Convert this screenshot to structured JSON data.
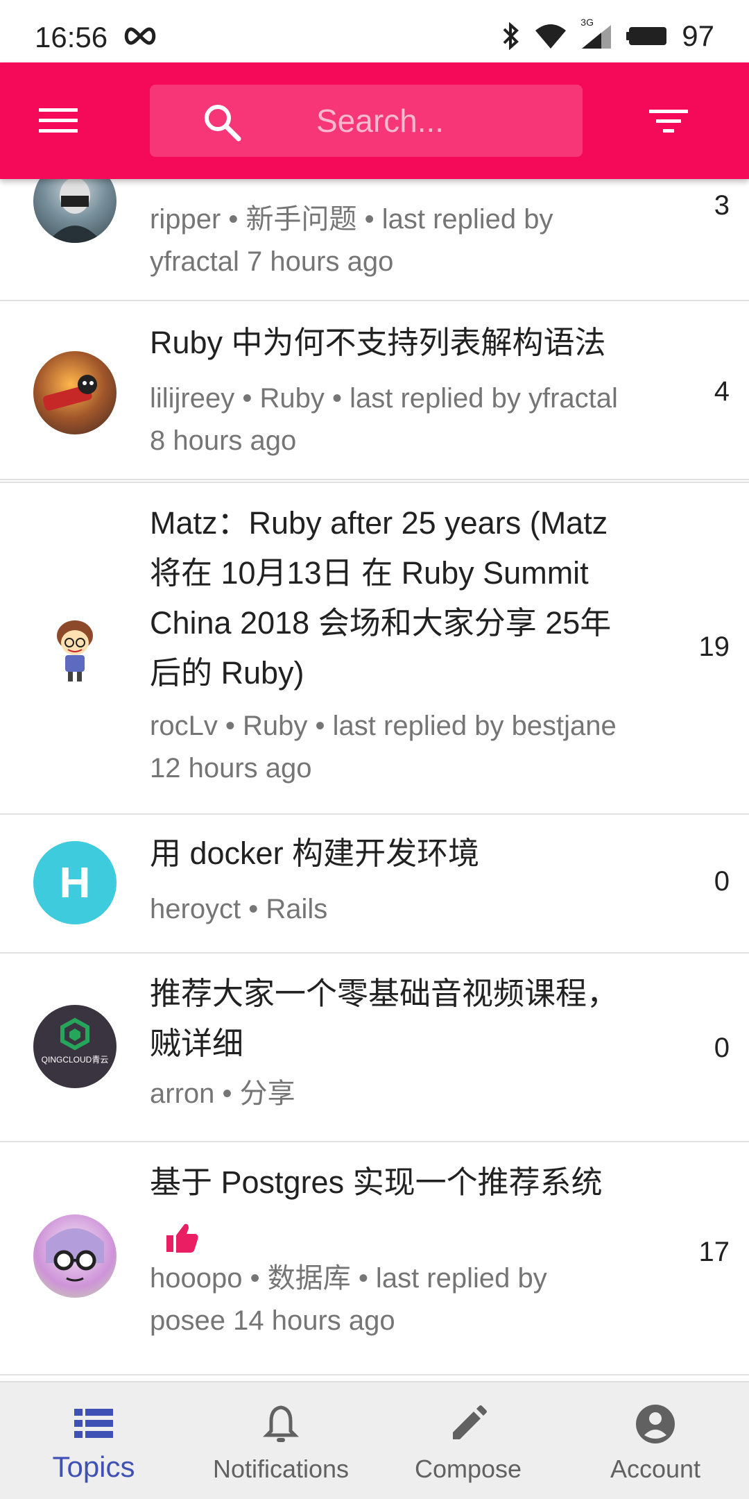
{
  "status_bar": {
    "time": "16:56",
    "battery": "97",
    "network": "3G"
  },
  "search": {
    "placeholder": "Search..."
  },
  "topics": [
    {
      "title": "",
      "author": "ripper",
      "node": "新手问题",
      "meta_line1": "ripper • 新手问题 • last replied by",
      "meta_line2": "yfractal 7 hours ago",
      "replies": "3"
    },
    {
      "title_lines": [
        "Ruby 中为何不支持列表解构语法"
      ],
      "meta_line1": "lilijreey • Ruby • last replied by yfractal",
      "meta_line2": "8 hours ago",
      "replies": "4"
    },
    {
      "title_lines": [
        "Matz：Ruby after 25 years (Matz",
        "将在 10月13日 在 Ruby Summit",
        "China 2018 会场和大家分享 25年",
        "后的 Ruby)"
      ],
      "meta_line1": "rocLv • Ruby • last replied by bestjane",
      "meta_line2": "12 hours ago",
      "replies": "19"
    },
    {
      "title_lines": [
        "用 docker 构建开发环境"
      ],
      "meta_line1": "heroyct • Rails",
      "meta_line2": "",
      "replies": "0",
      "avatar_letter": "H"
    },
    {
      "title_lines": [
        "推荐大家一个零基础音视频课程，",
        "贼详细"
      ],
      "meta_line1": "arron • 分享",
      "meta_line2": "",
      "replies": "0",
      "avatar_text": "QINGCLOUD青云"
    },
    {
      "title_lines": [
        "基于 Postgres 实现一个推荐系统"
      ],
      "meta_line1": "hooopo • 数据库 • last replied by",
      "meta_line2": "posee 14 hours ago",
      "replies": "17",
      "badge_icon": "thumbs-up-icon"
    }
  ],
  "bottom_nav": [
    {
      "label": "Topics",
      "icon": "list-icon",
      "active": true
    },
    {
      "label": "Notifications",
      "icon": "bell-icon",
      "active": false
    },
    {
      "label": "Compose",
      "icon": "pencil-icon",
      "active": false
    },
    {
      "label": "Account",
      "icon": "account-circle-icon",
      "active": false
    }
  ],
  "colors": {
    "primary": "#f50a5a",
    "active_nav": "#3f51b5",
    "meta_text": "#757575"
  }
}
